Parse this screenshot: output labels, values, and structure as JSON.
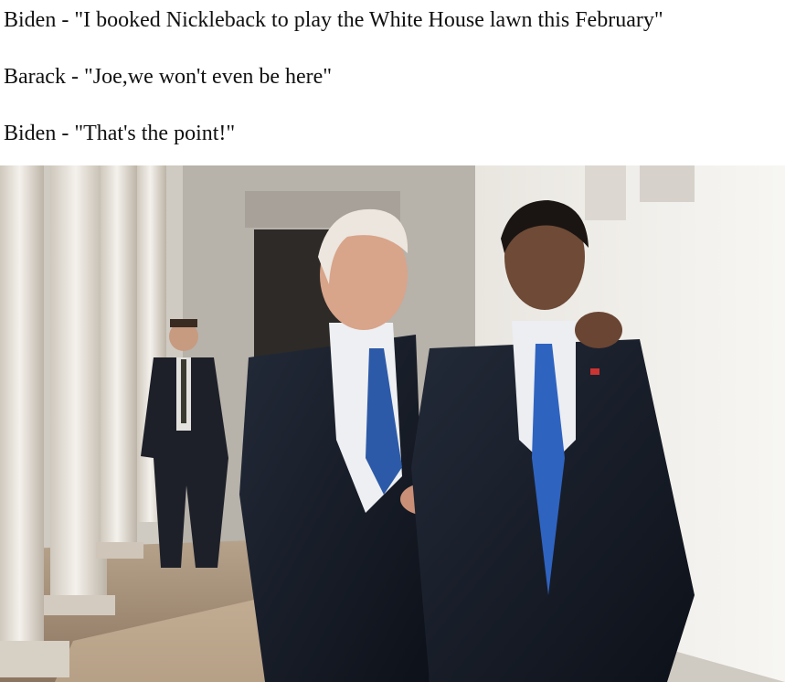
{
  "caption": {
    "line1": "Biden - \"I booked Nickleback to play the White House lawn this February\"",
    "line2": "Barack - \"Joe,we won't even be here\"",
    "line3": "Biden - \"That's the point!\""
  },
  "photo": {
    "subject": "two-men-walking-colonnade"
  }
}
